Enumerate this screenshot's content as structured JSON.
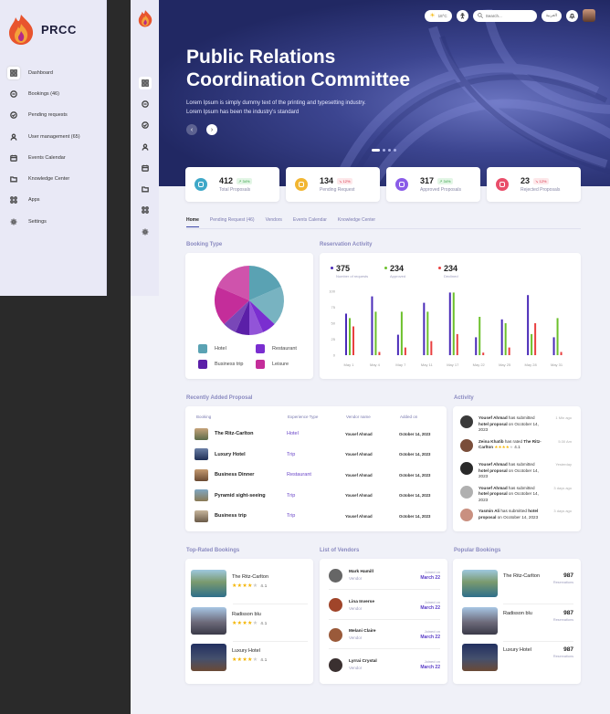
{
  "app": {
    "name": "PRCC"
  },
  "nav": [
    {
      "label": "Dashboard",
      "icon": "grid-icon",
      "active": true
    },
    {
      "label": "Bookings (46)",
      "icon": "bookings-icon"
    },
    {
      "label": "Pending requests",
      "icon": "check-circle-icon"
    },
    {
      "label": "User management  (65)",
      "icon": "user-icon"
    },
    {
      "label": "Events Calendar",
      "icon": "calendar-icon"
    },
    {
      "label": "Knowledge Center",
      "icon": "folder-icon"
    },
    {
      "label": "Apps",
      "icon": "apps-icon"
    },
    {
      "label": "Settings",
      "icon": "gear-icon"
    }
  ],
  "topbar": {
    "temp": "18°C",
    "search_placeholder": "Search...",
    "lang": "العربية"
  },
  "hero": {
    "title_line1": "Public Relations",
    "title_line2": "Coordination Committee",
    "sub": "Lorem Ipsum is simply dummy text of the printing and typesetting industry. Lorem Ipsum has been the industry's standard"
  },
  "stats": [
    {
      "value": "412",
      "pct": "34%",
      "label": "Total Proposals",
      "dir": "up",
      "color": "#3fa8c8"
    },
    {
      "value": "134",
      "pct": "12%",
      "label": "Pending Request",
      "dir": "down",
      "color": "#f2b632"
    },
    {
      "value": "317",
      "pct": "34%",
      "label": "Approved Proposals",
      "dir": "up",
      "color": "#8a5ce8"
    },
    {
      "value": "23",
      "pct": "12%",
      "label": "Rejected Proposals",
      "dir": "down",
      "color": "#e94e6a"
    }
  ],
  "tabs": [
    "Home",
    "Pending Request (46)",
    "Vendors",
    "Events Calendar",
    "Knowledge Center"
  ],
  "sections": {
    "booking_type": "Booking Type",
    "reservation": "Reservation Activity",
    "recent": "Recently Added Proposal",
    "activity": "Activity",
    "top_rated": "Top-Rated Bookings",
    "vendors": "List of Vendors",
    "popular": "Popular Bookings"
  },
  "pie": {
    "legend": [
      "Hotel",
      "Restaurant",
      "Business trip",
      "Leisure"
    ]
  },
  "reservation": {
    "totals": [
      {
        "v": "375",
        "l": "Number of requests",
        "c": "#4a2bb8"
      },
      {
        "v": "234",
        "l": "Approved",
        "c": "#6cc02c"
      },
      {
        "v": "234",
        "l": "Declined",
        "c": "#e94040"
      }
    ]
  },
  "chart_data": [
    {
      "type": "pie",
      "legend": [
        "Hotel",
        "Restaurant",
        "Business trip",
        "Leisure"
      ],
      "colors": [
        "#5aa2b3",
        "#7a2ed0",
        "#5b1fa8",
        "#c42d9a"
      ],
      "values": [
        37,
        13,
        13,
        37
      ]
    },
    {
      "type": "bar",
      "categories": [
        "May 1",
        "May 4",
        "May 7",
        "May 11",
        "May 17",
        "May 22",
        "May 25",
        "May 28",
        "May 31"
      ],
      "ylim": [
        0,
        100
      ],
      "yticks": [
        "0",
        "25",
        "50",
        "75",
        "100"
      ],
      "series": [
        {
          "name": "Number of requests",
          "color": "#4a2bb8",
          "values": [
            65,
            92,
            32,
            82,
            98,
            28,
            56,
            94,
            28
          ]
        },
        {
          "name": "Approved",
          "color": "#6cc02c",
          "values": [
            58,
            68,
            68,
            68,
            98,
            60,
            50,
            33,
            58
          ]
        },
        {
          "name": "Declined",
          "color": "#e94040",
          "values": [
            45,
            5,
            12,
            22,
            33,
            4,
            12,
            50,
            5
          ]
        }
      ]
    }
  ],
  "table": {
    "headers": [
      "Booking",
      "Experience Type",
      "Vendor name",
      "Added on"
    ],
    "rows": [
      {
        "name": "The Ritz-Carlton",
        "type": "Hotel",
        "vendor": "Yousef Ahmad",
        "date": "October 14, 2023"
      },
      {
        "name": "Luxury Hotel",
        "type": "Trip",
        "vendor": "Yousef Ahmad",
        "date": "October 14, 2023"
      },
      {
        "name": "Business Dinner",
        "type": "Restaurant",
        "vendor": "Yousef Ahmad",
        "date": "October 14, 2023"
      },
      {
        "name": "Pyramid sight-seeing",
        "type": "Trip",
        "vendor": "Yousef Ahmad",
        "date": "October 14, 2023"
      },
      {
        "name": "Business trip",
        "type": "Trip",
        "vendor": "Yousef Ahmad",
        "date": "October 14, 2023"
      }
    ]
  },
  "activity": [
    {
      "who": "Yousef Ahmad",
      "mid": " has submitted ",
      "what": "hotel proposal",
      "tail": " on Ocotober 14, 2023",
      "time": "1 Min ago"
    },
    {
      "who": "Zeina Khatib",
      "mid": " has rated ",
      "what": "The Ritz-Carlton",
      "rating": "4.1",
      "time": "5:30 Am"
    },
    {
      "who": "Yousef Ahmad",
      "mid": " has submitted ",
      "what": "hotel proposal",
      "tail": " on Ocotober 14, 2023",
      "time": "Yesterday"
    },
    {
      "who": "Yousef Ahmad",
      "mid": " has submitted ",
      "what": "hotel proposal",
      "tail": " on Ocotober 14, 2023",
      "time": "3 days ago"
    },
    {
      "who": "Yasmin Ali",
      "mid": " has submitted ",
      "what": "hotel proposal",
      "tail": " on Ocotober 14, 2023",
      "time": "3 days ago"
    }
  ],
  "top_rated": [
    {
      "name": "The Ritz-Carlton",
      "rating": "4.1",
      "stars": 4
    },
    {
      "name": "Radisson blu",
      "rating": "4.1",
      "stars": 4
    },
    {
      "name": "Luxury Hotel",
      "rating": "4.1",
      "stars": 4
    }
  ],
  "vendors": [
    {
      "name": "Mark Hamill",
      "role": "Vendor",
      "joined_label": "Joined on",
      "joined": "March 22"
    },
    {
      "name": "Lina Inverse",
      "role": "Vendor",
      "joined_label": "Joined on",
      "joined": "March 22"
    },
    {
      "name": "Melani Claire",
      "role": "Vendor",
      "joined_label": "Joined on",
      "joined": "March 22"
    },
    {
      "name": "Lyrrai Crystal",
      "role": "Vendor",
      "joined_label": "Joined on",
      "joined": "March 22"
    }
  ],
  "popular": [
    {
      "name": "The Ritz-Carlton",
      "count": "987",
      "label": "Reservations"
    },
    {
      "name": "Radisson blu",
      "count": "987",
      "label": "Reservations"
    },
    {
      "name": "Luxury Hotel",
      "count": "987",
      "label": "Reservations"
    }
  ]
}
